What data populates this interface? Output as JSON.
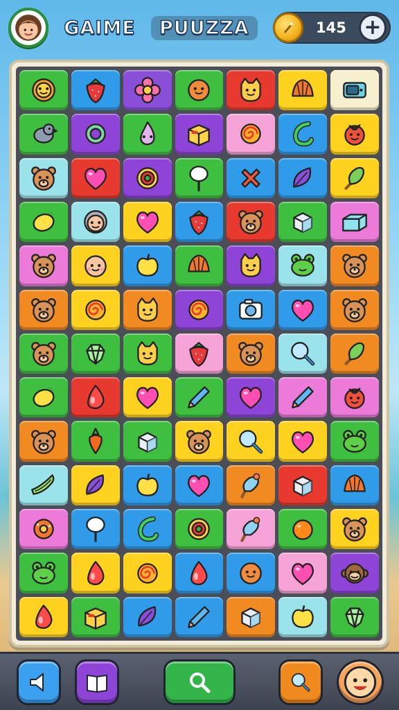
{
  "header": {
    "title_left": "GAIME",
    "title_right": "PUUZZA",
    "coin_count": "145"
  },
  "palette": {
    "green": "#3fbf3f",
    "blue": "#2f9be9",
    "violet": "#8a4fd9",
    "red": "#e8392e",
    "yellow": "#ffd21f",
    "cream": "#f6f0cf",
    "purple": "#8e44d6",
    "pink": "#f6a3d8",
    "teal": "#9be3ea",
    "orange": "#f28a22",
    "lime": "#8fd23a",
    "magenta": "#ec7ad9"
  },
  "board": {
    "rows": [
      [
        {
          "c": "green",
          "i": "flower-face-icon"
        },
        {
          "c": "blue",
          "i": "strawberry-icon"
        },
        {
          "c": "violet",
          "i": "flower-icon"
        },
        {
          "c": "green",
          "i": "sun-face-icon"
        },
        {
          "c": "red",
          "i": "cat-face-icon"
        },
        {
          "c": "yellow",
          "i": "shell-icon"
        },
        {
          "c": "cream",
          "i": "device-icon"
        }
      ],
      [
        {
          "c": "green",
          "i": "bird-icon"
        },
        {
          "c": "purple",
          "i": "ring-icon"
        },
        {
          "c": "green",
          "i": "drop-face-icon"
        },
        {
          "c": "purple",
          "i": "box-icon"
        },
        {
          "c": "pink",
          "i": "swirl-icon"
        },
        {
          "c": "blue",
          "i": "hook-icon"
        },
        {
          "c": "yellow",
          "i": "tomato-face-icon"
        }
      ],
      [
        {
          "c": "teal",
          "i": "bear-face-icon"
        },
        {
          "c": "red",
          "i": "heart-icon"
        },
        {
          "c": "purple",
          "i": "target-icon"
        },
        {
          "c": "green",
          "i": "lollipop-icon"
        },
        {
          "c": "blue",
          "i": "cross-icon"
        },
        {
          "c": "blue",
          "i": "leaf-icon"
        },
        {
          "c": "yellow",
          "i": "popsicle-icon"
        }
      ],
      [
        {
          "c": "green",
          "i": "lemon-icon"
        },
        {
          "c": "teal",
          "i": "grandma-face-icon"
        },
        {
          "c": "yellow",
          "i": "heart-icon"
        },
        {
          "c": "blue",
          "i": "strawberry-icon"
        },
        {
          "c": "red",
          "i": "bear-face-icon"
        },
        {
          "c": "green",
          "i": "cube-icon"
        },
        {
          "c": "magenta",
          "i": "block-icon"
        }
      ],
      [
        {
          "c": "magenta",
          "i": "bear-face-icon"
        },
        {
          "c": "yellow",
          "i": "baby-face-icon"
        },
        {
          "c": "blue",
          "i": "apple-icon"
        },
        {
          "c": "green",
          "i": "shell-icon"
        },
        {
          "c": "purple",
          "i": "cat-face-icon"
        },
        {
          "c": "teal",
          "i": "frog-face-icon"
        },
        {
          "c": "orange",
          "i": "bear-face-icon"
        }
      ],
      [
        {
          "c": "orange",
          "i": "bear-face-icon"
        },
        {
          "c": "yellow",
          "i": "swirl-icon"
        },
        {
          "c": "orange",
          "i": "cat-face-icon"
        },
        {
          "c": "purple",
          "i": "swirl-icon"
        },
        {
          "c": "blue",
          "i": "camera-icon"
        },
        {
          "c": "blue",
          "i": "heart-icon"
        },
        {
          "c": "orange",
          "i": "bear-face-icon"
        }
      ],
      [
        {
          "c": "green",
          "i": "bear-face-icon"
        },
        {
          "c": "green",
          "i": "gem-icon"
        },
        {
          "c": "green",
          "i": "cat-face-icon"
        },
        {
          "c": "pink",
          "i": "strawberry-icon"
        },
        {
          "c": "orange",
          "i": "bear-face-icon"
        },
        {
          "c": "teal",
          "i": "magnifier-icon"
        },
        {
          "c": "orange",
          "i": "popsicle-icon"
        }
      ],
      [
        {
          "c": "green",
          "i": "lemon-icon"
        },
        {
          "c": "red",
          "i": "drop-icon"
        },
        {
          "c": "yellow",
          "i": "heart-icon"
        },
        {
          "c": "green",
          "i": "pencil-icon"
        },
        {
          "c": "purple",
          "i": "heart-icon"
        },
        {
          "c": "magenta",
          "i": "pencil-icon"
        },
        {
          "c": "magenta",
          "i": "tomato-face-icon"
        }
      ],
      [
        {
          "c": "orange",
          "i": "bear-face-icon"
        },
        {
          "c": "green",
          "i": "carrot-icon"
        },
        {
          "c": "green",
          "i": "cube-icon"
        },
        {
          "c": "yellow",
          "i": "bear-face-icon"
        },
        {
          "c": "yellow",
          "i": "magnifier-icon"
        },
        {
          "c": "yellow",
          "i": "heart-icon"
        },
        {
          "c": "green",
          "i": "frog-face-icon"
        }
      ],
      [
        {
          "c": "teal",
          "i": "banana-icon"
        },
        {
          "c": "yellow",
          "i": "leaf-icon"
        },
        {
          "c": "blue",
          "i": "apple-icon"
        },
        {
          "c": "blue",
          "i": "heart-icon"
        },
        {
          "c": "orange",
          "i": "ice-cream-icon"
        },
        {
          "c": "red",
          "i": "cube-icon"
        },
        {
          "c": "blue",
          "i": "shell-icon"
        }
      ],
      [
        {
          "c": "magenta",
          "i": "donut-icon"
        },
        {
          "c": "blue",
          "i": "lollipop-icon"
        },
        {
          "c": "blue",
          "i": "hook-icon"
        },
        {
          "c": "green",
          "i": "target-icon"
        },
        {
          "c": "pink",
          "i": "ice-cream-icon"
        },
        {
          "c": "green",
          "i": "orange-icon"
        },
        {
          "c": "yellow",
          "i": "bear-face-icon"
        }
      ],
      [
        {
          "c": "green",
          "i": "frog-face-icon"
        },
        {
          "c": "yellow",
          "i": "drop-icon"
        },
        {
          "c": "yellow",
          "i": "swirl-icon"
        },
        {
          "c": "blue",
          "i": "drop-icon"
        },
        {
          "c": "blue",
          "i": "sun-face-icon"
        },
        {
          "c": "pink",
          "i": "heart-icon"
        },
        {
          "c": "purple",
          "i": "monkey-face-icon"
        }
      ],
      [
        {
          "c": "yellow",
          "i": "drop-icon"
        },
        {
          "c": "green",
          "i": "box-icon"
        },
        {
          "c": "blue",
          "i": "leaf-icon"
        },
        {
          "c": "blue",
          "i": "pencil-icon"
        },
        {
          "c": "orange",
          "i": "cube-icon"
        },
        {
          "c": "teal",
          "i": "apple-icon"
        },
        {
          "c": "green",
          "i": "gem-icon"
        }
      ]
    ]
  },
  "footer": {
    "buttons": [
      {
        "name": "sound-button",
        "icon": "speaker-icon",
        "color": "#3aa0ef"
      },
      {
        "name": "book-button",
        "icon": "book-icon",
        "color": "#8e44d6"
      },
      {
        "name": "search-button",
        "icon": "search-icon",
        "color": "#33b54a"
      },
      {
        "name": "hint-button",
        "icon": "magnifier-icon",
        "color": "#f08a1e"
      },
      {
        "name": "profile-button",
        "icon": "smile-face-icon",
        "color": "#f6a35a"
      }
    ]
  }
}
